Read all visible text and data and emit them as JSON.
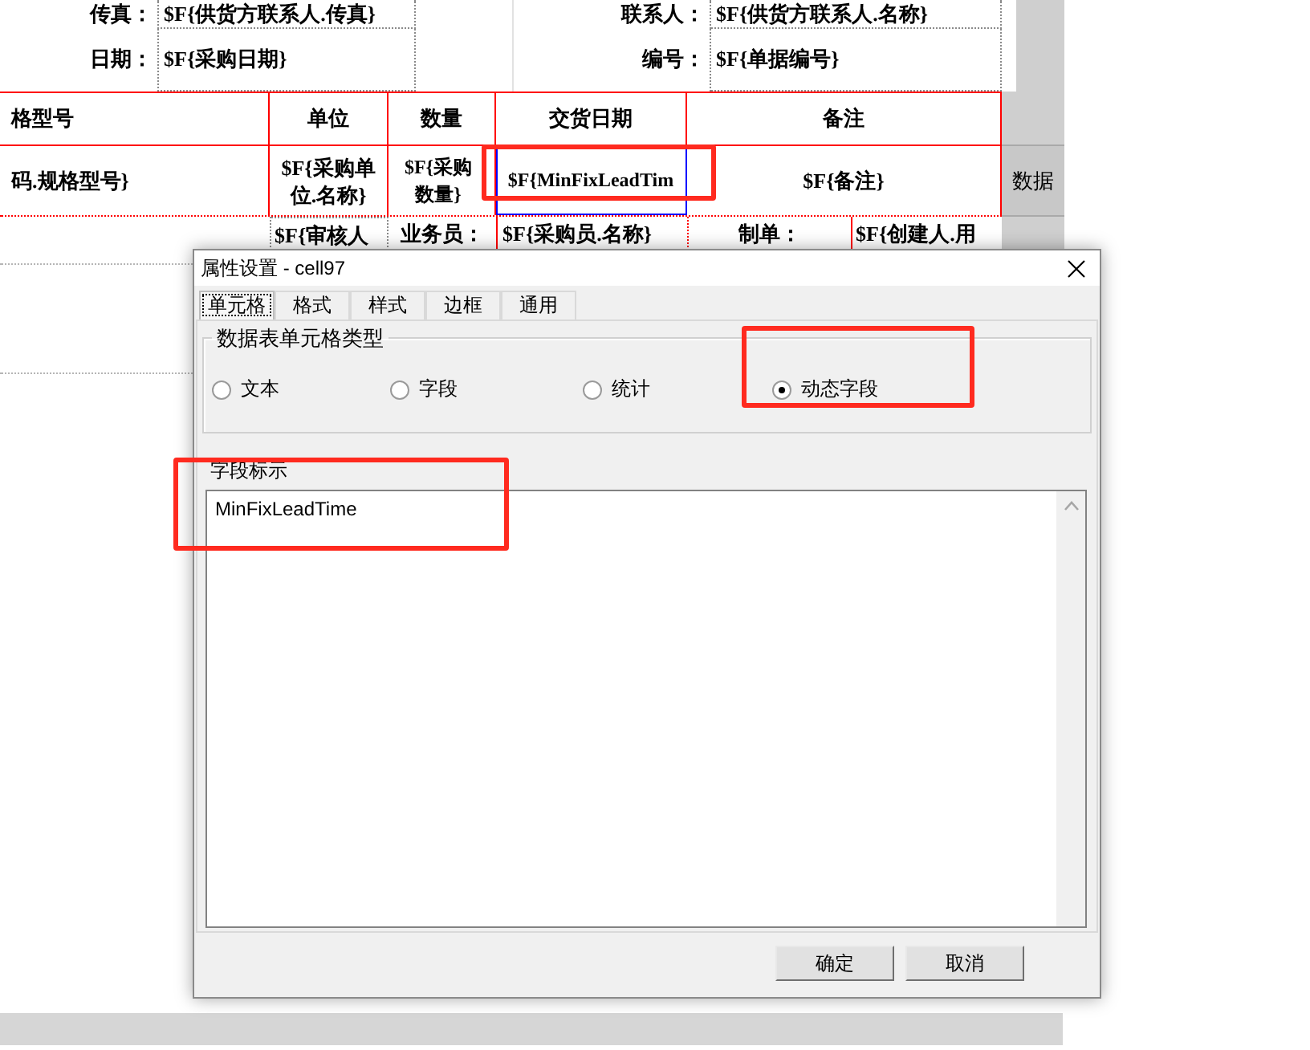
{
  "sheet": {
    "top_rows": [
      {
        "label": "传真：",
        "value": "$F{供货方联系人.传真}",
        "label_2": "联系人：",
        "value_2": "$F{供货方联系人.名称}"
      },
      {
        "label": "日期：",
        "value": "$F{采购日期}",
        "label_2": "编号：",
        "value_2": "$F{单据编号}"
      }
    ],
    "columns": [
      "格型号",
      "单位",
      "数量",
      "交货日期",
      "备注"
    ],
    "data_row": [
      {
        "text": "码.规格型号}",
        "selected": false
      },
      {
        "text": "$F{采购单位.名称}",
        "selected": false
      },
      {
        "text": "$F{采购数量}",
        "selected": false
      },
      {
        "text": "$F{MinFixLeadTim",
        "selected": true
      },
      {
        "text": "$F{备注}",
        "selected": false
      }
    ],
    "row_label": "数据",
    "footer_row": [
      "$F{审核人",
      "业务员：",
      "$F{采购员.名称}",
      "制单：",
      "$F{创建人.用"
    ]
  },
  "dialog": {
    "title": "属性设置 - cell97",
    "tabs": [
      {
        "label": "单元格",
        "selected": true
      },
      {
        "label": "格式",
        "selected": false
      },
      {
        "label": "样式",
        "selected": false
      },
      {
        "label": "边框",
        "selected": false
      },
      {
        "label": "通用",
        "selected": false
      }
    ],
    "group": {
      "title": "数据表单元格类型",
      "options": [
        {
          "label": "文本",
          "selected": false
        },
        {
          "label": "字段",
          "selected": false
        },
        {
          "label": "统计",
          "selected": false
        },
        {
          "label": "动态字段",
          "selected": true
        }
      ]
    },
    "field": {
      "label": "字段标示",
      "value": "MinFixLeadTime"
    },
    "buttons": [
      "确定",
      "取消"
    ]
  }
}
